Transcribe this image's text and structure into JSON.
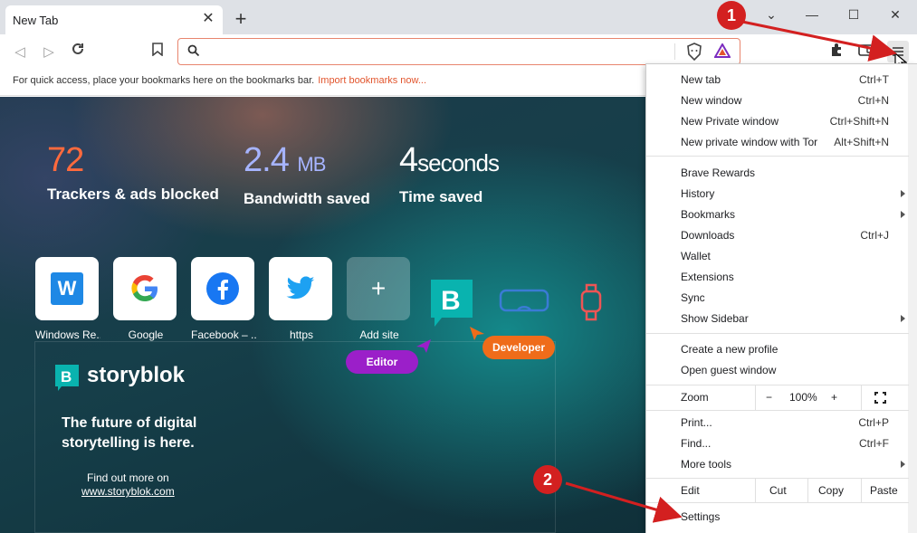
{
  "tab": {
    "title": "New Tab"
  },
  "bookmarks_bar": {
    "hint": "For quick access, place your bookmarks here on the bookmarks bar.",
    "import_link": "Import bookmarks now..."
  },
  "stats": [
    {
      "value": "72",
      "unit": "",
      "label": "Trackers & ads blocked",
      "color": "#ff6a3d"
    },
    {
      "value": "2.4",
      "unit": "MB",
      "label": "Bandwidth saved",
      "color": "#a6b4ff"
    },
    {
      "value": "4",
      "unit": "seconds",
      "label": "Time saved",
      "color": "#ffffff"
    }
  ],
  "top_sites": [
    {
      "label": "Windows Re...",
      "icon": "windows-report-icon"
    },
    {
      "label": "Google",
      "icon": "google-icon"
    },
    {
      "label": "Facebook – ...",
      "icon": "facebook-icon"
    },
    {
      "label": "https",
      "icon": "twitter-icon"
    },
    {
      "label": "Add site",
      "icon": "plus-icon"
    }
  ],
  "storyblok": {
    "brand": "storyblok",
    "tagline_1": "The future of digital",
    "tagline_2": "storytelling is here.",
    "more_1": "Find out more on",
    "more_2": "www.storyblok.com",
    "editor_label": "Editor",
    "developer_label": "Developer"
  },
  "menu": {
    "group1": [
      {
        "label": "New tab",
        "shortcut": "Ctrl+T"
      },
      {
        "label": "New window",
        "shortcut": "Ctrl+N"
      },
      {
        "label": "New Private window",
        "shortcut": "Ctrl+Shift+N"
      },
      {
        "label": "New private window with Tor",
        "shortcut": "Alt+Shift+N"
      }
    ],
    "group2": [
      {
        "label": "Brave Rewards",
        "shortcut": ""
      },
      {
        "label": "History",
        "shortcut": ""
      },
      {
        "label": "Bookmarks",
        "shortcut": ""
      },
      {
        "label": "Downloads",
        "shortcut": "Ctrl+J"
      },
      {
        "label": "Wallet",
        "shortcut": ""
      },
      {
        "label": "Extensions",
        "shortcut": ""
      },
      {
        "label": "Sync",
        "shortcut": ""
      },
      {
        "label": "Show Sidebar",
        "shortcut": ""
      }
    ],
    "group3": [
      {
        "label": "Create a new profile"
      },
      {
        "label": "Open guest window"
      }
    ],
    "zoom": {
      "label": "Zoom",
      "minus": "−",
      "value": "100%",
      "plus": "+"
    },
    "group4": [
      {
        "label": "Print...",
        "shortcut": "Ctrl+P"
      },
      {
        "label": "Find...",
        "shortcut": "Ctrl+F"
      },
      {
        "label": "More tools",
        "shortcut": ""
      }
    ],
    "edit": {
      "label": "Edit",
      "cut": "Cut",
      "copy": "Copy",
      "paste": "Paste"
    },
    "settings": "Settings"
  },
  "annotations": {
    "badge1": "1",
    "badge2": "2"
  },
  "colors": {
    "accent": "#fb542b",
    "annotation": "#d32020"
  }
}
